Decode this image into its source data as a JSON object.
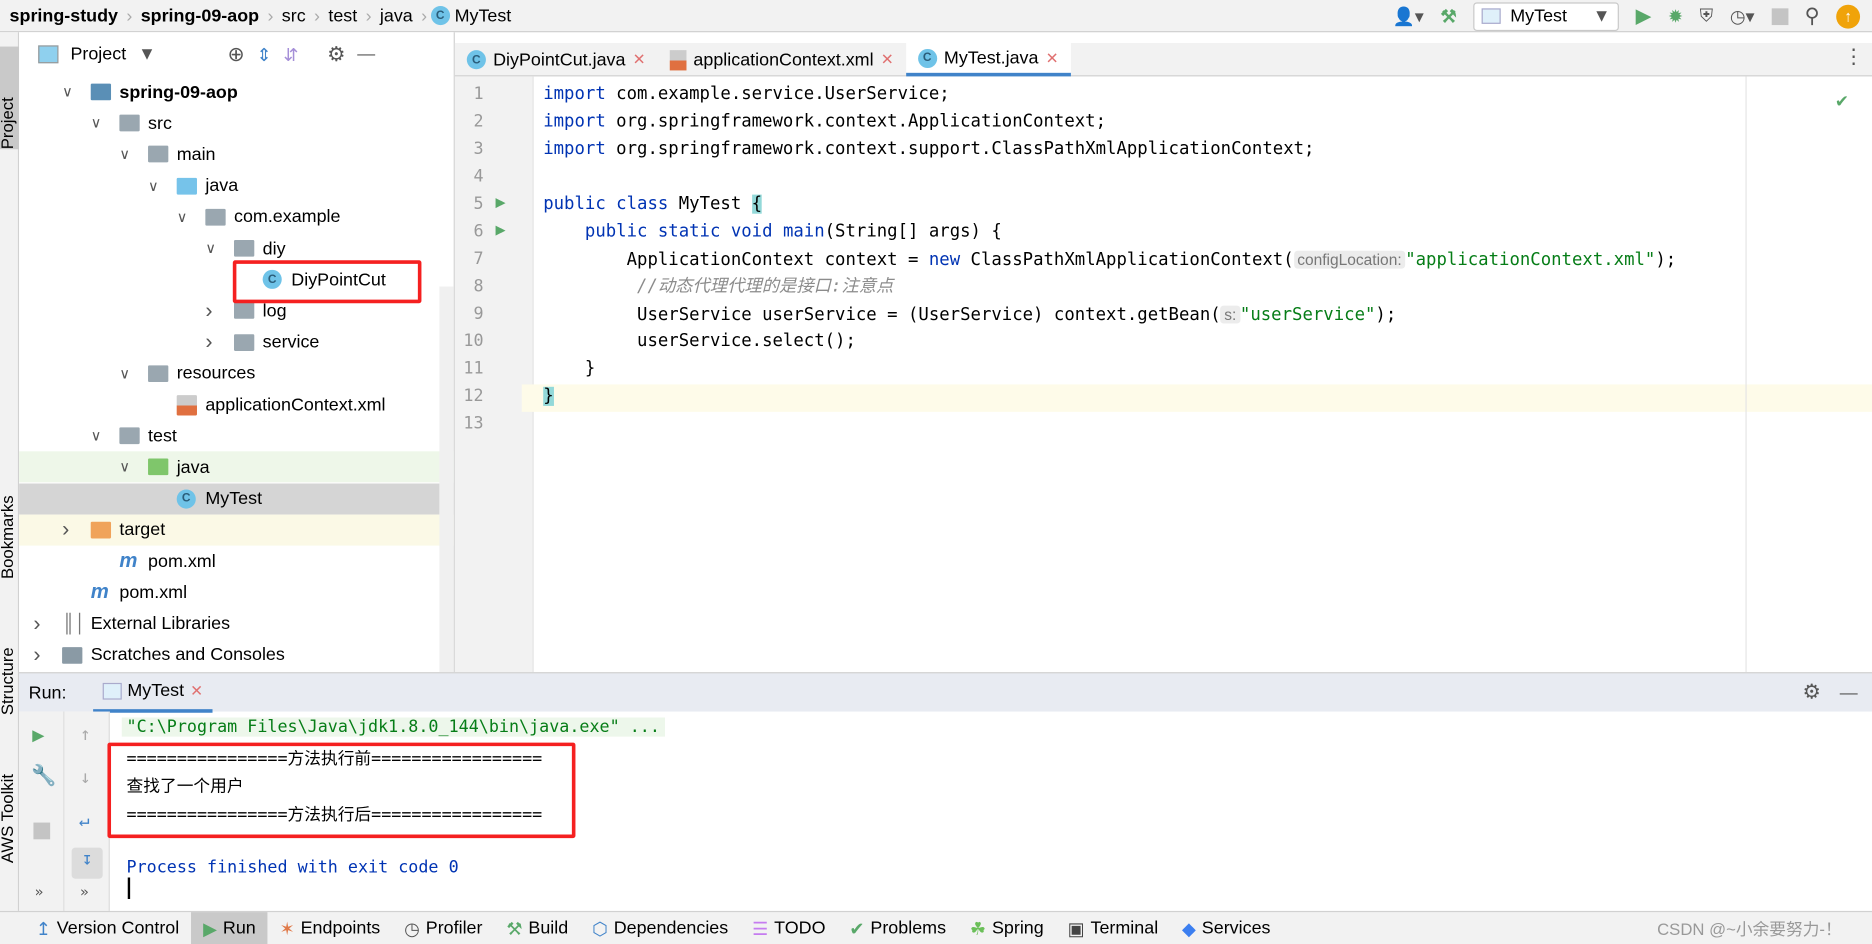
{
  "breadcrumb": [
    "spring-study",
    "spring-09-aop",
    "src",
    "test",
    "java",
    "MyTest"
  ],
  "toolbar": {
    "run_config": "MyTest"
  },
  "left_strip": [
    "Project",
    "Bookmarks",
    "Structure",
    "AWS Toolkit"
  ],
  "project": {
    "title": "Project",
    "tree": [
      {
        "label": "spring-09-aop",
        "depth": 1,
        "open": true,
        "icon": "module",
        "bold": true
      },
      {
        "label": "src",
        "depth": 2,
        "open": true,
        "icon": "folder"
      },
      {
        "label": "main",
        "depth": 3,
        "open": true,
        "icon": "folder"
      },
      {
        "label": "java",
        "depth": 4,
        "open": true,
        "icon": "source-folder"
      },
      {
        "label": "com.example",
        "depth": 5,
        "open": true,
        "icon": "package"
      },
      {
        "label": "diy",
        "depth": 6,
        "open": true,
        "icon": "package"
      },
      {
        "label": "DiyPointCut",
        "depth": 7,
        "icon": "class"
      },
      {
        "label": "log",
        "depth": 6,
        "open": false,
        "icon": "package"
      },
      {
        "label": "service",
        "depth": 6,
        "open": false,
        "icon": "package"
      },
      {
        "label": "resources",
        "depth": 3,
        "open": true,
        "icon": "resources"
      },
      {
        "label": "applicationContext.xml",
        "depth": 4,
        "icon": "xml"
      },
      {
        "label": "test",
        "depth": 2,
        "open": true,
        "icon": "folder"
      },
      {
        "label": "java",
        "depth": 3,
        "open": true,
        "icon": "test-folder",
        "state": "hover"
      },
      {
        "label": "MyTest",
        "depth": 4,
        "icon": "class",
        "state": "selected"
      },
      {
        "label": "target",
        "depth": 1,
        "open": false,
        "icon": "excluded-folder",
        "state": "excluded"
      },
      {
        "label": "pom.xml",
        "depth": 2,
        "icon": "maven"
      },
      {
        "label": "pom.xml",
        "depth": 1,
        "icon": "maven"
      },
      {
        "label": "External Libraries",
        "depth": 0,
        "open": false,
        "icon": "libraries"
      },
      {
        "label": "Scratches and Consoles",
        "depth": 0,
        "open": false,
        "icon": "scratches"
      }
    ]
  },
  "tabs": [
    {
      "label": "DiyPointCut.java",
      "icon": "class"
    },
    {
      "label": "applicationContext.xml",
      "icon": "xml"
    },
    {
      "label": "MyTest.java",
      "icon": "class",
      "active": true
    }
  ],
  "code": [
    [
      [
        "import ",
        "kw"
      ],
      [
        "com.example.service.UserService;",
        ""
      ]
    ],
    [
      [
        "import ",
        "kw"
      ],
      [
        "org.springframework.context.ApplicationContext;",
        ""
      ]
    ],
    [
      [
        "import ",
        "kw"
      ],
      [
        "org.springframework.context.support.ClassPathXmlApplicationContext;",
        ""
      ]
    ],
    [],
    [
      [
        "public class ",
        "kw"
      ],
      [
        "MyTest ",
        ""
      ],
      [
        "{",
        "br"
      ]
    ],
    [
      [
        "    public static void ",
        "kw"
      ],
      [
        "main",
        "kw"
      ],
      [
        "(String[] args) {",
        ""
      ]
    ],
    [
      [
        "        ApplicationContext context = ",
        ""
      ],
      [
        "new ",
        "kw"
      ],
      [
        "ClassPathXmlApplicationContext(",
        ""
      ],
      [
        "configLocation:",
        "hint"
      ],
      [
        "\"applicationContext.xml\"",
        "str"
      ],
      [
        ");",
        ""
      ]
    ],
    [
      [
        "         //动态代理代理的是接口:注意点",
        "cm"
      ]
    ],
    [
      [
        "         UserService userService = (UserService) context.getBean(",
        ""
      ],
      [
        "s:",
        "hint"
      ],
      [
        "\"userService\"",
        "str"
      ],
      [
        ");",
        ""
      ]
    ],
    [
      [
        "         userService.select();",
        ""
      ]
    ],
    [
      [
        "    }",
        ""
      ]
    ],
    [
      [
        "}",
        "br"
      ]
    ],
    []
  ],
  "run": {
    "label": "Run:",
    "tab": "MyTest",
    "console": [
      "\"C:\\Program Files\\Java\\jdk1.8.0_144\\bin\\java.exe\" ...",
      "================方法执行前=================",
      "查找了一个用户",
      "================方法执行后=================",
      "",
      "Process finished with exit code 0"
    ]
  },
  "status": [
    "Version Control",
    "Run",
    "Endpoints",
    "Profiler",
    "Build",
    "Dependencies",
    "TODO",
    "Problems",
    "Spring",
    "Terminal",
    "Services"
  ],
  "watermark": "CSDN @~小余要努力-！",
  "colors": {
    "accent": "#4083c9",
    "run_green": "#59a869",
    "highlight_red": "#f52020"
  }
}
